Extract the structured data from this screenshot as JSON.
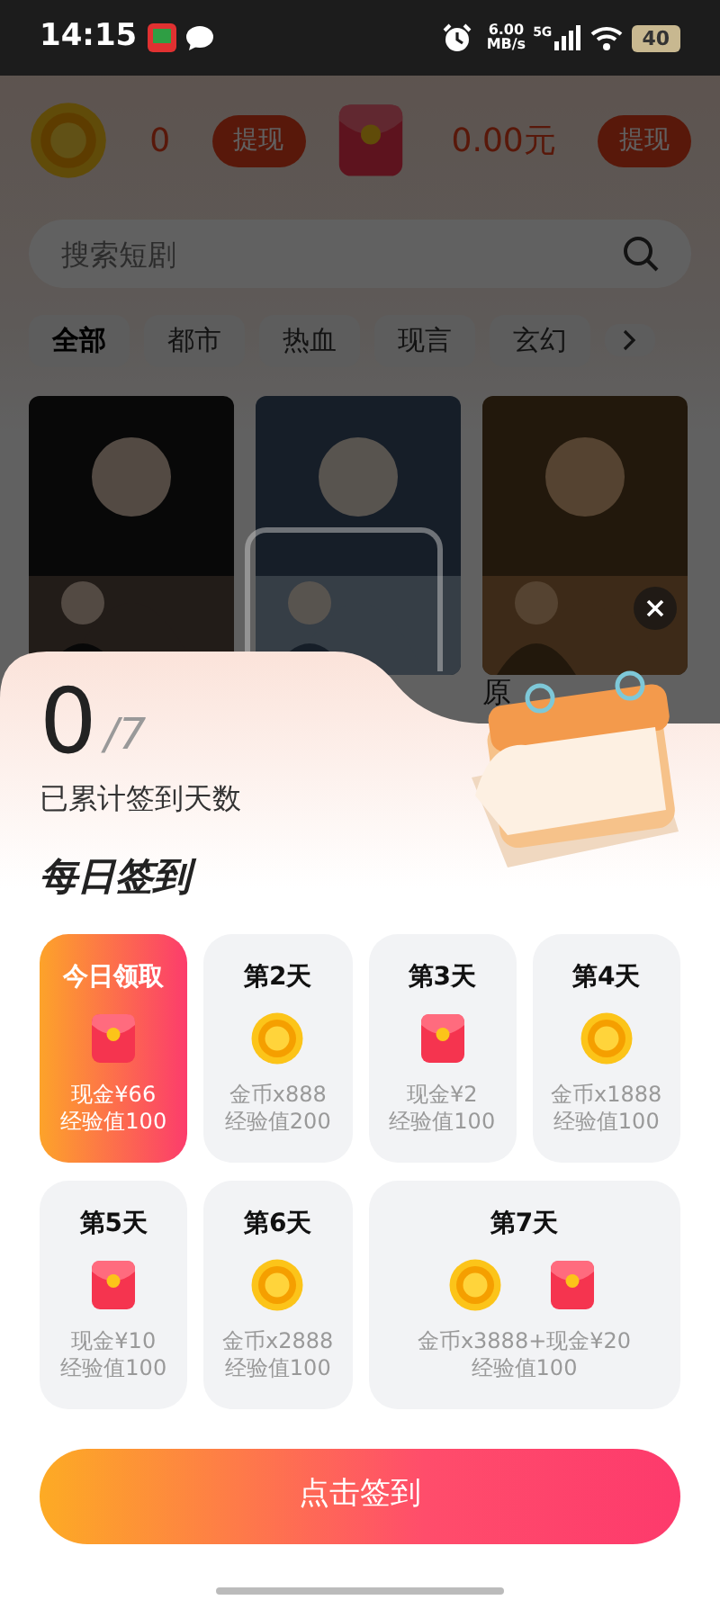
{
  "status_bar": {
    "time": "14:15",
    "speed_value": "6.00",
    "speed_unit": "MB/s",
    "network": "5G",
    "battery": "40"
  },
  "header": {
    "coins": "0",
    "coin_withdraw": "提现",
    "cash": "0.00元",
    "cash_withdraw": "提现"
  },
  "search": {
    "placeholder": "搜索短剧"
  },
  "categories": [
    {
      "label": "全部",
      "selected": true
    },
    {
      "label": "都市",
      "selected": false
    },
    {
      "label": "热血",
      "selected": false
    },
    {
      "label": "现言",
      "selected": false
    },
    {
      "label": "玄幻",
      "selected": false
    }
  ],
  "posters": [
    {
      "kind": "picture"
    },
    {
      "kind": "picture"
    },
    {
      "kind": "picture",
      "title": "原"
    }
  ],
  "checkin": {
    "count": "0",
    "total": "/7",
    "caption": "已累计签到天数",
    "title": "每日签到",
    "days": [
      {
        "label": "今日领取",
        "selected": true,
        "wide": false,
        "icons": [
          {
            "kind": "redpacket"
          }
        ],
        "lines": [
          "现金¥66",
          "经验值100"
        ]
      },
      {
        "label": "第2天",
        "selected": false,
        "wide": false,
        "icons": [
          {
            "kind": "coin"
          }
        ],
        "lines": [
          "金币x888",
          "经验值200"
        ]
      },
      {
        "label": "第3天",
        "selected": false,
        "wide": false,
        "icons": [
          {
            "kind": "redpacket"
          }
        ],
        "lines": [
          "现金¥2",
          "经验值100"
        ]
      },
      {
        "label": "第4天",
        "selected": false,
        "wide": false,
        "icons": [
          {
            "kind": "coin"
          }
        ],
        "lines": [
          "金币x1888",
          "经验值100"
        ]
      },
      {
        "label": "第5天",
        "selected": false,
        "wide": false,
        "icons": [
          {
            "kind": "redpacket"
          }
        ],
        "lines": [
          "现金¥10",
          "经验值100"
        ]
      },
      {
        "label": "第6天",
        "selected": false,
        "wide": false,
        "icons": [
          {
            "kind": "coin"
          }
        ],
        "lines": [
          "金币x2888",
          "经验值100"
        ]
      },
      {
        "label": "第7天",
        "selected": false,
        "wide": true,
        "icons": [
          {
            "kind": "coin"
          },
          {
            "kind": "redpacket"
          }
        ],
        "lines": [
          "金币x3888+现金¥20",
          "经验值100"
        ]
      }
    ],
    "button": "点击签到"
  }
}
